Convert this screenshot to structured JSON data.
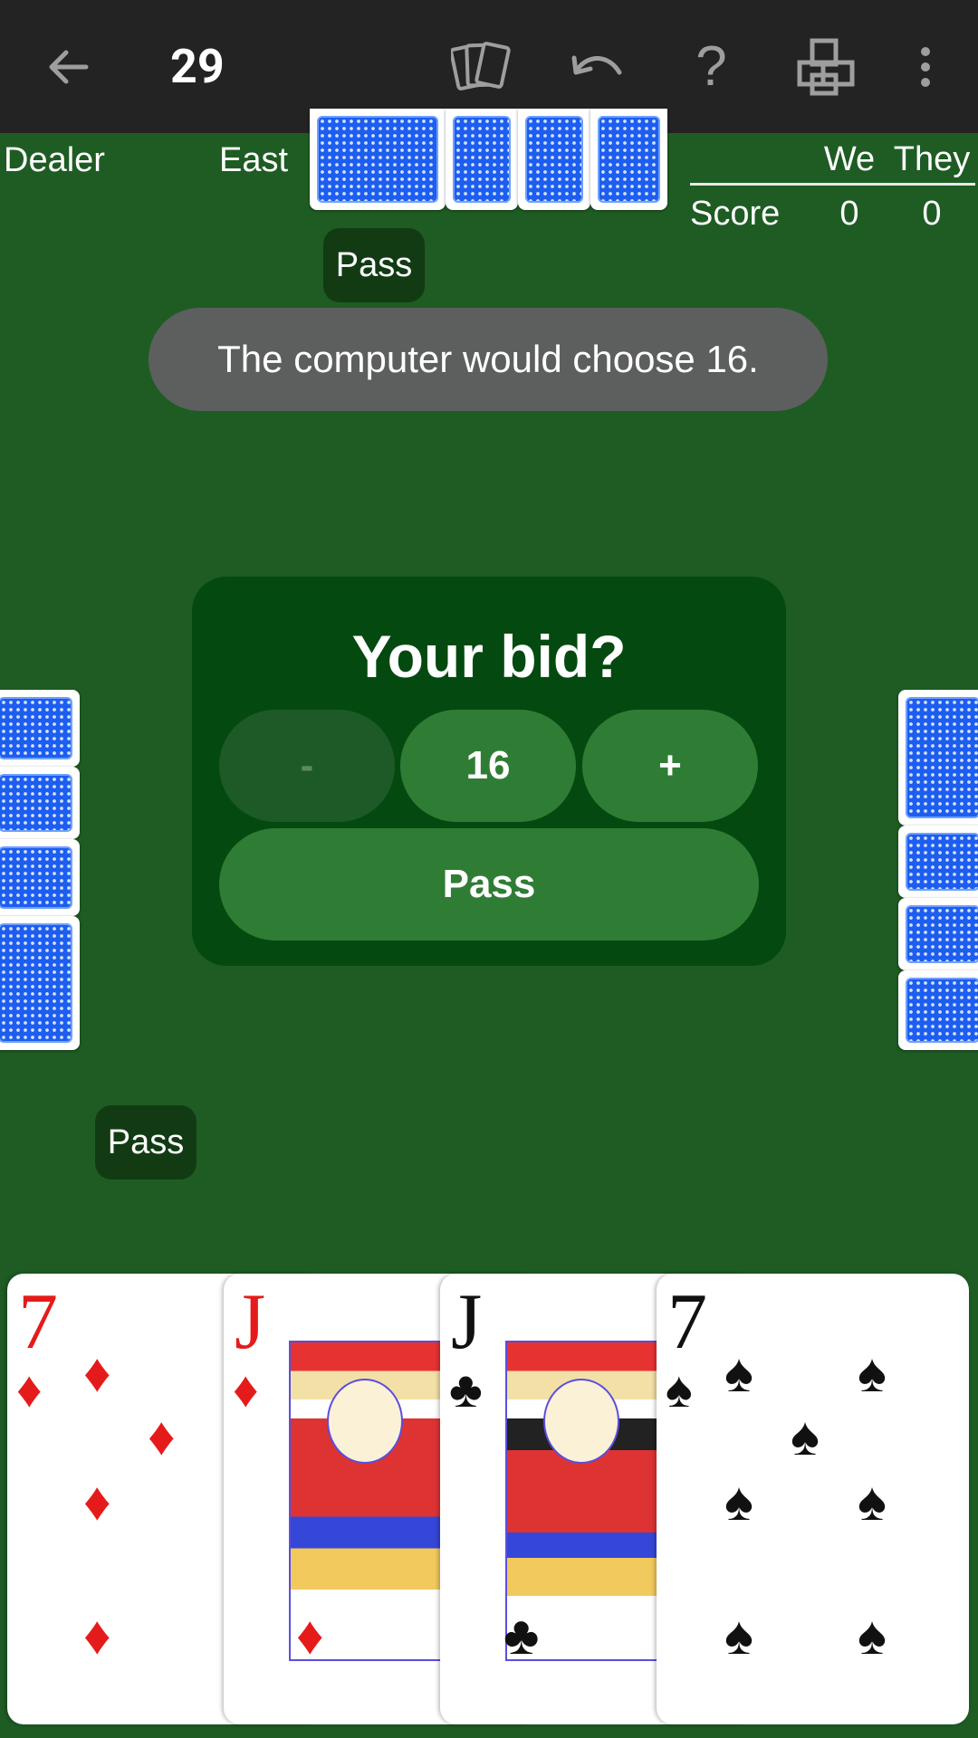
{
  "toolbar": {
    "title": "29",
    "help_label": "?"
  },
  "table": {
    "dealer_label": "Dealer",
    "east_label": "East",
    "north_bid": "Pass",
    "south_bid": "Pass"
  },
  "score": {
    "we_header": "We",
    "they_header": "They",
    "row_label": "Score",
    "we_value": "0",
    "they_value": "0"
  },
  "hint": "The computer would choose 16.",
  "bid_dialog": {
    "title": "Your bid?",
    "minus_label": "-",
    "value": "16",
    "plus_label": "+",
    "pass_label": "Pass"
  },
  "hand": {
    "cards": [
      {
        "rank": "7",
        "suit": "♦",
        "color": "red",
        "icon": "seven-of-diamonds"
      },
      {
        "rank": "J",
        "suit": "♦",
        "color": "red",
        "icon": "jack-of-diamonds"
      },
      {
        "rank": "J",
        "suit": "♣",
        "color": "black",
        "icon": "jack-of-clubs"
      },
      {
        "rank": "7",
        "suit": "♠",
        "color": "black",
        "icon": "seven-of-spades"
      }
    ]
  },
  "colors": {
    "felt": "#1e5c23",
    "toolbar": "#232323",
    "dialog": "#044a10",
    "button": "#2f7d35",
    "hint_bg": "#5d5f5e",
    "card_back": "#1d5ef0"
  }
}
